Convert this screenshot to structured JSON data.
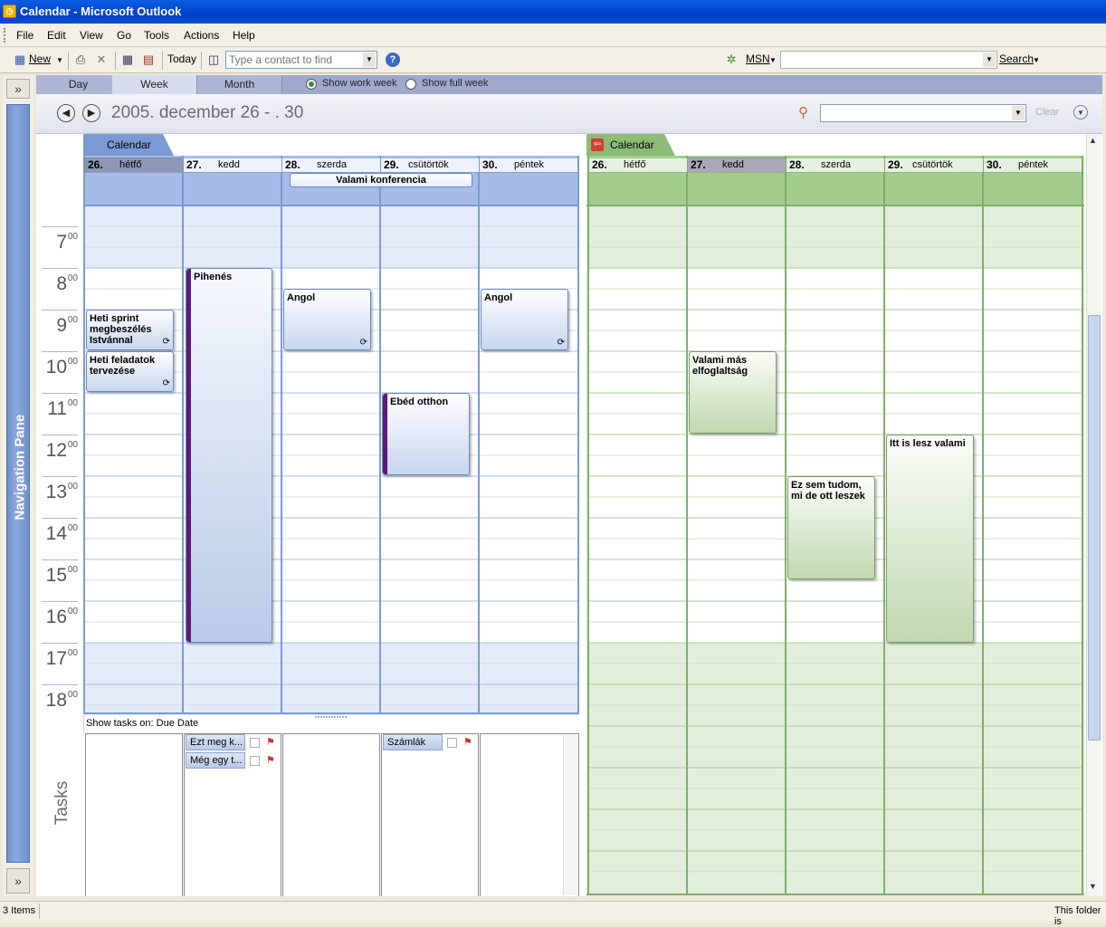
{
  "window": {
    "title": "Calendar - Microsoft Outlook"
  },
  "menu": [
    "File",
    "Edit",
    "View",
    "Go",
    "Tools",
    "Actions",
    "Help"
  ],
  "toolbar": {
    "new_label": "New",
    "today_label": "Today",
    "contact_placeholder": "Type a contact to find",
    "msn_label": "MSN",
    "search_label": "Search"
  },
  "nav_pane": {
    "label": "Navigation Pane",
    "expand_icon": "»"
  },
  "view_tabs": [
    {
      "label": "Day",
      "active": false
    },
    {
      "label": "Week",
      "active": true
    },
    {
      "label": "Month",
      "active": false
    }
  ],
  "week_options": {
    "work_week": "Show work week",
    "full_week": "Show full week",
    "selected": "work_week"
  },
  "date_range": "2005. december 26 - . 30",
  "search": {
    "value": "",
    "clear_label": "Clear"
  },
  "hours": [
    {
      "h": "7",
      "m": "00"
    },
    {
      "h": "8",
      "m": "00"
    },
    {
      "h": "9",
      "m": "00"
    },
    {
      "h": "10",
      "m": "00"
    },
    {
      "h": "11",
      "m": "00"
    },
    {
      "h": "12",
      "m": "00"
    },
    {
      "h": "13",
      "m": "00"
    },
    {
      "h": "14",
      "m": "00"
    },
    {
      "h": "15",
      "m": "00"
    },
    {
      "h": "16",
      "m": "00"
    },
    {
      "h": "17",
      "m": "00"
    },
    {
      "h": "18",
      "m": "00"
    }
  ],
  "calendars": [
    {
      "name": "Calendar",
      "color": "#7b9ad4",
      "days": [
        {
          "num": "26.",
          "name": "hétfő"
        },
        {
          "num": "27.",
          "name": "kedd"
        },
        {
          "num": "28.",
          "name": "szerda"
        },
        {
          "num": "29.",
          "name": "csütörtök"
        },
        {
          "num": "30.",
          "name": "péntek"
        }
      ],
      "all_day_event": "Valami konferencia",
      "events": [
        {
          "title": "Pihenés"
        },
        {
          "title": "Angol"
        },
        {
          "title": "Angol"
        },
        {
          "title": "Heti sprint megbeszélés Istvánnal"
        },
        {
          "title": "Heti feladatok tervezése"
        },
        {
          "title": "Ebéd otthon"
        }
      ]
    },
    {
      "name": "Calendar",
      "color": "#7fae6a",
      "days": [
        {
          "num": "26.",
          "name": "hétfő"
        },
        {
          "num": "27.",
          "name": "kedd"
        },
        {
          "num": "28.",
          "name": "szerda"
        },
        {
          "num": "29.",
          "name": "csütörtök"
        },
        {
          "num": "30.",
          "name": "péntek"
        }
      ],
      "events": [
        {
          "title": "Valami más elfoglaltság"
        },
        {
          "title": "Ez sem tudom, mi de ott leszek"
        },
        {
          "title": "Itt is lesz valami"
        }
      ]
    }
  ],
  "tasks": {
    "header": "Show tasks on: Due Date",
    "label": "Tasks",
    "items": [
      {
        "title": "Ezt meg k..."
      },
      {
        "title": "Még egy t..."
      },
      {
        "title": "Számlák"
      }
    ]
  },
  "status": {
    "items": "3 Items",
    "right": "This folder is"
  }
}
